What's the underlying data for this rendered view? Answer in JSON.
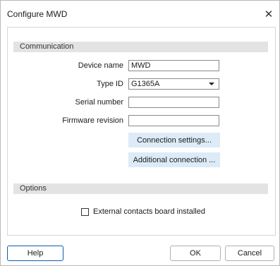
{
  "window": {
    "title": "Configure MWD"
  },
  "sections": {
    "communication": "Communication",
    "options": "Options"
  },
  "form": {
    "device_name": {
      "label": "Device name",
      "value": "MWD"
    },
    "type_id": {
      "label": "Type ID",
      "value": "G1365A"
    },
    "serial_number": {
      "label": "Serial number",
      "value": ""
    },
    "firmware_revision": {
      "label": "Firmware revision",
      "value": ""
    }
  },
  "buttons": {
    "connection_settings": "Connection settings...",
    "additional_connection": "Additional connection ...",
    "help": "Help",
    "ok": "OK",
    "cancel": "Cancel"
  },
  "options": {
    "external_contacts": {
      "label": "External contacts board installed",
      "checked": false
    }
  }
}
